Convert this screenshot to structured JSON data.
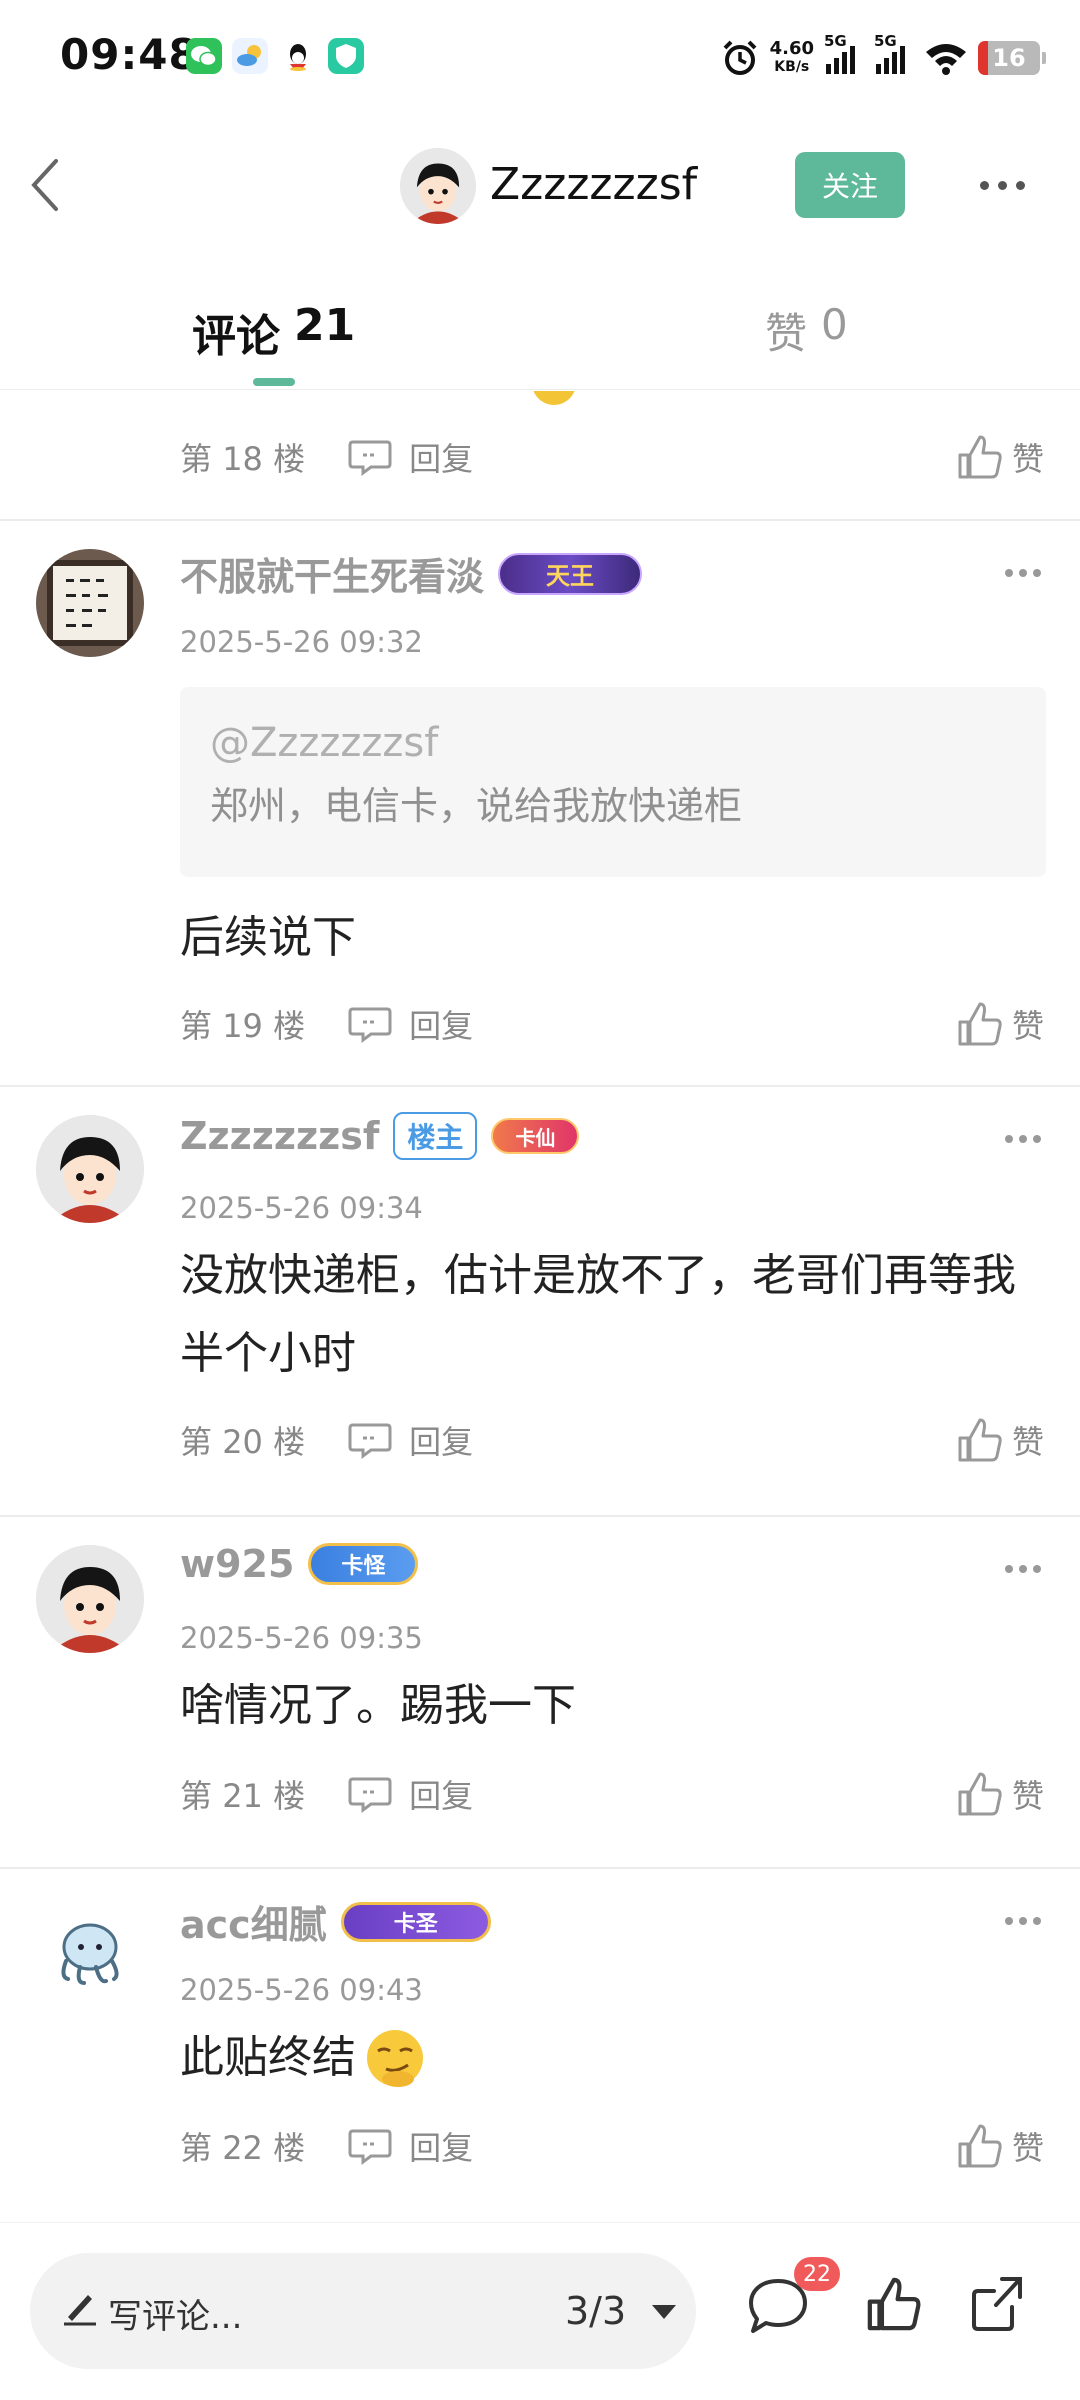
{
  "status_bar": {
    "time": "09:48",
    "network_speed_value": "4.60",
    "network_speed_unit": "KB/s",
    "signal1_label": "5G",
    "signal2_label": "5G",
    "battery": "16",
    "icons": [
      "wechat-icon",
      "weather-icon",
      "qq-icon",
      "shield-app-icon",
      "alarm-icon",
      "wifi-icon"
    ]
  },
  "header": {
    "username": "Zzzzzzzsf",
    "follow_label": "关注"
  },
  "tabs": {
    "comments_label": "评论",
    "comments_count": "21",
    "likes_label": "赞",
    "likes_count": "0"
  },
  "floor_prefix": "第",
  "floor_suffix": "楼",
  "reply_label": "回复",
  "like_label": "赞",
  "partial_row": {
    "floor": "18"
  },
  "comments": [
    {
      "username": "不服就干生死看淡",
      "badge": "天王",
      "time": "2025-5-26 09:32",
      "quote_user": "@Zzzzzzzsf",
      "quote_text": "郑州，电信卡，说给我放快递柜",
      "text": "后续说下",
      "floor": "19"
    },
    {
      "username": "Zzzzzzzsf",
      "owner_badge": "楼主",
      "badge": "卡仙",
      "time": "2025-5-26 09:34",
      "text": "没放快递柜，估计是放不了，老哥们再等我半个小时",
      "floor": "20"
    },
    {
      "username": "w925",
      "badge": "卡怪",
      "time": "2025-5-26 09:35",
      "text": "啥情况了。踢我一下",
      "floor": "21"
    },
    {
      "username": "acc细腻",
      "badge": "卡圣",
      "time": "2025-5-26 09:43",
      "text": "此贴终结",
      "floor": "22"
    }
  ],
  "bottom_bar": {
    "placeholder": "写评论...",
    "pager": "3/3",
    "comment_count": "22"
  },
  "colors": {
    "accent": "#5db99a",
    "badge_red": "#f05a5a",
    "owner_blue": "#4a9be3"
  }
}
